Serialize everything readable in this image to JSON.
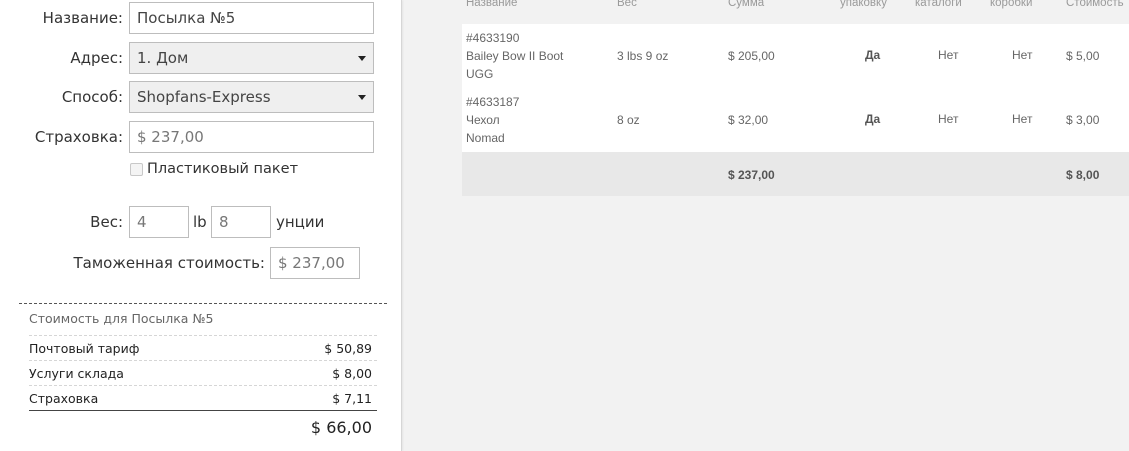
{
  "form": {
    "name_label": "Название:",
    "name_value": "Посылка №5",
    "address_label": "Адрес:",
    "address_value": "1. Дом",
    "method_label": "Способ:",
    "method_value": "Shopfans-Express",
    "insurance_label": "Страховка:",
    "insurance_value": "$ 237,00",
    "plastic_bag_label": "Пластиковый пакет",
    "weight_label": "Вес:",
    "weight_lb": "4",
    "weight_lb_unit": "lb",
    "weight_oz": "8",
    "weight_oz_unit": "унции",
    "customs_label": "Таможенная стоимость:",
    "customs_value": "$ 237,00"
  },
  "cost": {
    "title": "Стоимость для Посылка №5",
    "rows": [
      {
        "name": "Почтовый тариф",
        "value": "$ 50,89"
      },
      {
        "name": "Услуги склада",
        "value": "$ 8,00"
      },
      {
        "name": "Страховка",
        "value": "$ 7,11"
      }
    ],
    "total": "$ 66,00"
  },
  "table": {
    "headers": [
      "Название",
      "Вес",
      "Сумма",
      "упаковку",
      "каталоги",
      "коробки",
      "Стоимость"
    ],
    "rows": [
      {
        "id": "#4633190",
        "title": "Bailey Bow II Boot",
        "brand": "UGG",
        "weight": "3 lbs 9 oz",
        "sum": "$ 205,00",
        "packaging": "Да",
        "catalogs": "Нет",
        "boxes": "Нет",
        "cost": "$ 5,00"
      },
      {
        "id": "#4633187",
        "title": "Чехол",
        "brand": "Nomad",
        "weight": "8 oz",
        "sum": "$ 32,00",
        "packaging": "Да",
        "catalogs": "Нет",
        "boxes": "Нет",
        "cost": "$ 3,00"
      }
    ],
    "footer": {
      "sum": "$ 237,00",
      "cost": "$ 8,00"
    }
  }
}
